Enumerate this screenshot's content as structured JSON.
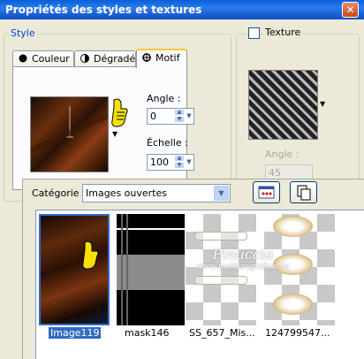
{
  "window": {
    "title": "Propriétés des styles et textures",
    "close_glyph": "✕"
  },
  "style_group": {
    "legend": "Style",
    "tabs": [
      {
        "label": "Couleur",
        "icon": "color-circle-icon"
      },
      {
        "label": "Dégradé",
        "icon": "gradient-circle-icon"
      },
      {
        "label": "Motif",
        "icon": "pattern-icon"
      }
    ],
    "active_tab": "Motif"
  },
  "pattern": {
    "angle_label": "Angle :",
    "angle_value": "0",
    "scale_label": "Échelle :",
    "scale_value": "100"
  },
  "texture_group": {
    "label": "Texture",
    "checked": false,
    "angle_label": "Angle :",
    "angle_value": "45"
  },
  "popup": {
    "category_label": "Catégorie :",
    "category_value": "Images ouvertes",
    "items": [
      {
        "label": "Image119",
        "selected": true
      },
      {
        "label": "mask146",
        "selected": false
      },
      {
        "label": "SS_657_Mis...",
        "selected": false
      },
      {
        "label": "124799547...",
        "selected": false
      }
    ]
  },
  "watermark": {
    "main": "Pinuccia",
    "sub": "www.maldiregrafica.eu"
  },
  "colors": {
    "title_blue": "#0a5fd8",
    "legend_blue": "#0046d5",
    "selection": "#316ac5",
    "tab_highlight": "#ffc83c"
  }
}
